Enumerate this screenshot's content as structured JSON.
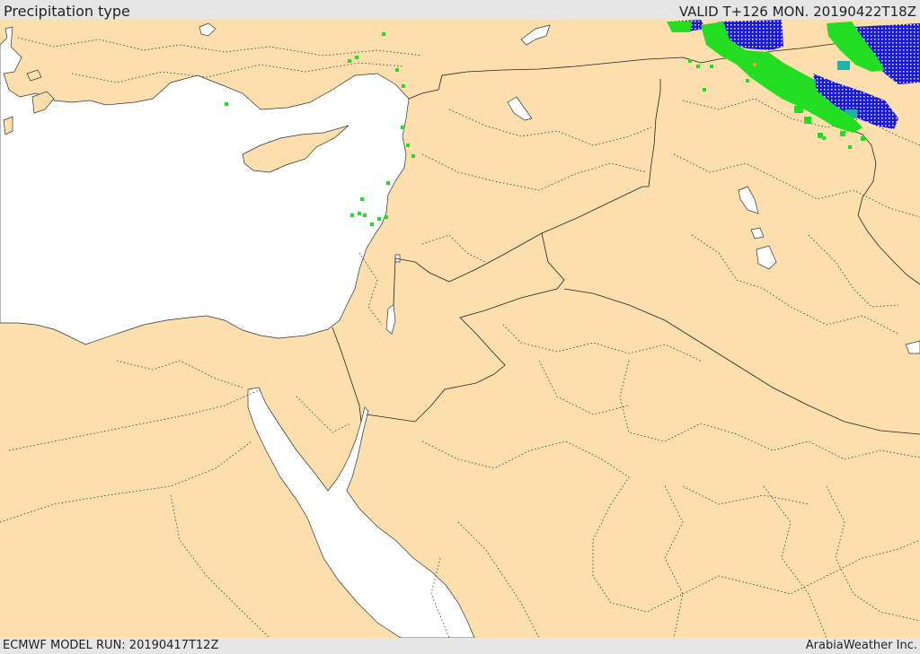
{
  "header": {
    "title": "Precipitation type",
    "valid": "VALID T+126 MON. 20190422T18Z"
  },
  "footer": {
    "model_run": "ECMWF MODEL RUN: 20190417T12Z",
    "credit": "ArabiaWeather Inc."
  },
  "colors": {
    "land": "#fddfad",
    "sea": "#ffffff",
    "background": "#e6e6e6",
    "rain": "#22dd22",
    "snow": "#1a1ad6",
    "mixed": "#20b2aa"
  }
}
